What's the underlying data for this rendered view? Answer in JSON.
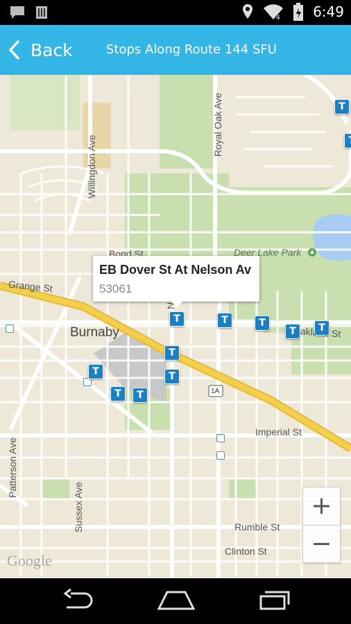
{
  "status_bar": {
    "time": "6:49"
  },
  "action_bar": {
    "back_label": "Back",
    "title": "Stops Along Route 144 SFU"
  },
  "map": {
    "street_labels": {
      "royal_oak": "Royal Oak Ave",
      "willingdon": "Willingdon Ave",
      "bond": "Bond St",
      "grange": "Grange St",
      "nelson": "Nel",
      "oakland": "Oakland St",
      "imperial": "Imperial St",
      "patterson": "Patterson Ave",
      "sussex": "Sussex Ave",
      "rumble": "Rumble St",
      "clinton": "Clinton St",
      "highway": "1A"
    },
    "place_labels": {
      "burnaby": "Burnaby",
      "deer_lake_park": "Deer Lake Park"
    },
    "info_window": {
      "stop_name": "EB Dover St At Nelson Av",
      "stop_number": "53061"
    },
    "stop_marker_glyph": "T",
    "zoom": {
      "in": "+",
      "out": "−"
    },
    "attribution": "Google"
  },
  "colors": {
    "action_bar": "#33b5e5",
    "stop_marker": "#1c7fc2",
    "highway": "#f3cf4a",
    "park": "#c9dfb0",
    "water": "#a9cdf2",
    "land": "#eee8d9"
  },
  "icons": [
    "notification-icon",
    "sim-icon",
    "location-icon",
    "wifi-icon",
    "battery-icon",
    "back-chevron-icon",
    "nav-back-icon",
    "nav-home-icon",
    "nav-recents-icon"
  ]
}
